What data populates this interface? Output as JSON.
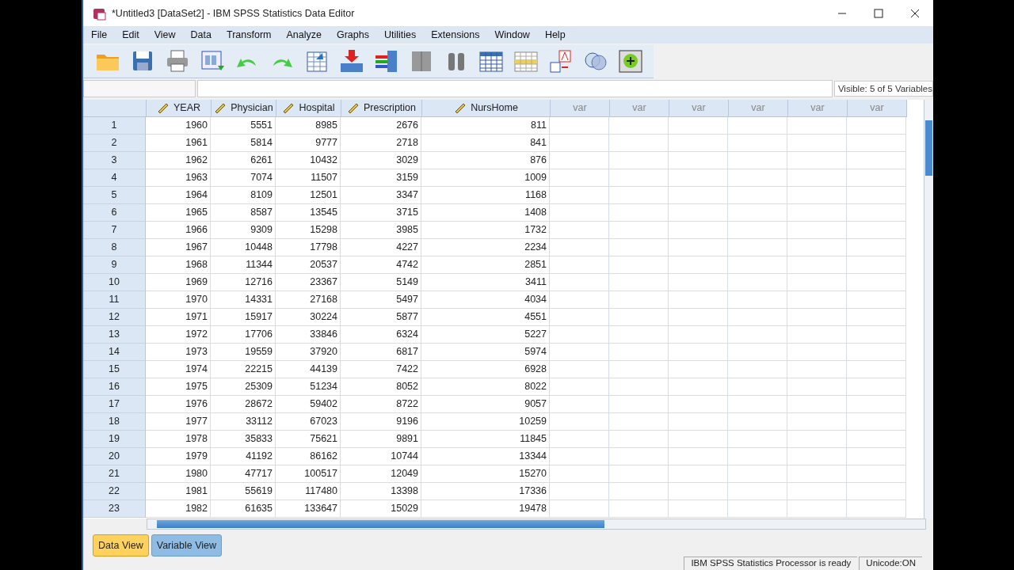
{
  "window": {
    "title": "*Untitled3 [DataSet2] - IBM SPSS Statistics Data Editor"
  },
  "menu": [
    "File",
    "Edit",
    "View",
    "Data",
    "Transform",
    "Analyze",
    "Graphs",
    "Utilities",
    "Extensions",
    "Window",
    "Help"
  ],
  "visible_label": "Visible: 5 of 5 Variables",
  "table": {
    "columns": [
      {
        "name": "YEAR",
        "kind": "variable"
      },
      {
        "name": "Physician",
        "kind": "variable"
      },
      {
        "name": "Hospital",
        "kind": "variable"
      },
      {
        "name": "Prescription",
        "kind": "variable"
      },
      {
        "name": "NursHome",
        "kind": "variable"
      },
      {
        "name": "var",
        "kind": "empty"
      },
      {
        "name": "var",
        "kind": "empty"
      },
      {
        "name": "var",
        "kind": "empty"
      },
      {
        "name": "var",
        "kind": "empty"
      },
      {
        "name": "var",
        "kind": "empty"
      },
      {
        "name": "var",
        "kind": "empty"
      }
    ],
    "rows": [
      {
        "label": "1",
        "cells": [
          "1960",
          "5551",
          "8985",
          "2676",
          "811"
        ]
      },
      {
        "label": "2",
        "cells": [
          "1961",
          "5814",
          "9777",
          "2718",
          "841"
        ]
      },
      {
        "label": "3",
        "cells": [
          "1962",
          "6261",
          "10432",
          "3029",
          "876"
        ]
      },
      {
        "label": "4",
        "cells": [
          "1963",
          "7074",
          "11507",
          "3159",
          "1009"
        ]
      },
      {
        "label": "5",
        "cells": [
          "1964",
          "8109",
          "12501",
          "3347",
          "1168"
        ]
      },
      {
        "label": "6",
        "cells": [
          "1965",
          "8587",
          "13545",
          "3715",
          "1408"
        ]
      },
      {
        "label": "7",
        "cells": [
          "1966",
          "9309",
          "15298",
          "3985",
          "1732"
        ]
      },
      {
        "label": "8",
        "cells": [
          "1967",
          "10448",
          "17798",
          "4227",
          "2234"
        ]
      },
      {
        "label": "9",
        "cells": [
          "1968",
          "11344",
          "20537",
          "4742",
          "2851"
        ]
      },
      {
        "label": "10",
        "cells": [
          "1969",
          "12716",
          "23367",
          "5149",
          "3411"
        ]
      },
      {
        "label": "11",
        "cells": [
          "1970",
          "14331",
          "27168",
          "5497",
          "4034"
        ]
      },
      {
        "label": "12",
        "cells": [
          "1971",
          "15917",
          "30224",
          "5877",
          "4551"
        ]
      },
      {
        "label": "13",
        "cells": [
          "1972",
          "17706",
          "33846",
          "6324",
          "5227"
        ]
      },
      {
        "label": "14",
        "cells": [
          "1973",
          "19559",
          "37920",
          "6817",
          "5974"
        ]
      },
      {
        "label": "15",
        "cells": [
          "1974",
          "22215",
          "44139",
          "7422",
          "6928"
        ]
      },
      {
        "label": "16",
        "cells": [
          "1975",
          "25309",
          "51234",
          "8052",
          "8022"
        ]
      },
      {
        "label": "17",
        "cells": [
          "1976",
          "28672",
          "59402",
          "8722",
          "9057"
        ]
      },
      {
        "label": "18",
        "cells": [
          "1977",
          "33112",
          "67023",
          "9196",
          "10259"
        ]
      },
      {
        "label": "19",
        "cells": [
          "1978",
          "35833",
          "75621",
          "9891",
          "11845"
        ]
      },
      {
        "label": "20",
        "cells": [
          "1979",
          "41192",
          "86162",
          "10744",
          "13344"
        ]
      },
      {
        "label": "21",
        "cells": [
          "1980",
          "47717",
          "100517",
          "12049",
          "15270"
        ]
      },
      {
        "label": "22",
        "cells": [
          "1981",
          "55619",
          "117480",
          "13398",
          "17336"
        ]
      },
      {
        "label": "23",
        "cells": [
          "1982",
          "61635",
          "133647",
          "15029",
          "19478"
        ]
      }
    ]
  },
  "tabs": [
    {
      "label": "Data View",
      "selected": true
    },
    {
      "label": "Variable View",
      "selected": false
    }
  ],
  "status_bar": [
    "IBM SPSS Statistics Processor is ready",
    "Unicode:ON"
  ]
}
